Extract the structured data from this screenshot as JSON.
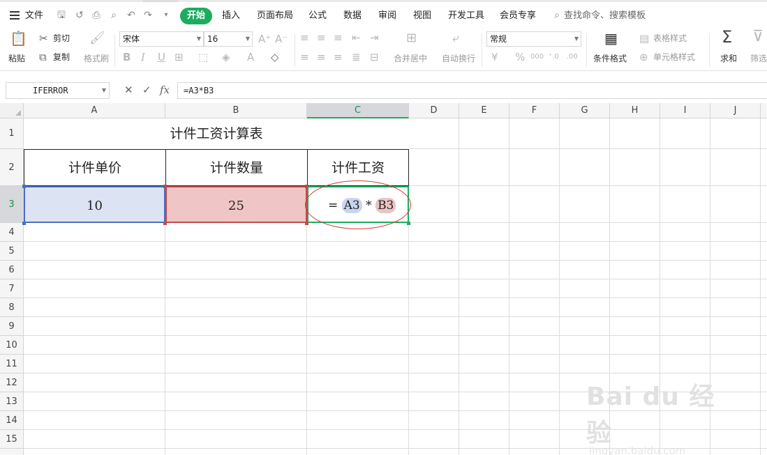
{
  "menubar": {
    "file": "文件",
    "tabs": [
      "开始",
      "插入",
      "页面布局",
      "公式",
      "数据",
      "审阅",
      "视图",
      "开发工具",
      "会员专享"
    ],
    "search": "查找命令、搜索模板"
  },
  "ribbon": {
    "paste": "粘贴",
    "cut": "剪切",
    "copy": "复制",
    "format_painter": "格式刷",
    "font_name": "宋体",
    "font_size": "16",
    "merge_center": "合并居中",
    "wrap_text": "自动换行",
    "number_format": "常规",
    "conditional_format": "条件格式",
    "table_style": "表格样式",
    "cell_style": "单元格样式",
    "sum": "求和",
    "filter": "筛选",
    "bold": "B",
    "italic": "I",
    "underline": "U",
    "currency": "¥",
    "percent": "%",
    "thousands": "000"
  },
  "formula_bar": {
    "name_box": "IFERROR",
    "cancel": "✕",
    "confirm": "✓",
    "fx": "fx",
    "formula": "=A3*B3"
  },
  "grid": {
    "columns": [
      "A",
      "B",
      "C",
      "D",
      "E",
      "F",
      "G",
      "H",
      "I",
      "J"
    ],
    "rows": [
      "1",
      "2",
      "3",
      "4",
      "5",
      "6",
      "7",
      "8",
      "9",
      "10",
      "11",
      "12",
      "13",
      "14",
      "15"
    ],
    "title": "计件工资计算表",
    "headers": [
      "计件单价",
      "计件数量",
      "计件工资"
    ],
    "values": {
      "a3": "10",
      "b3": "25"
    },
    "formula_display": {
      "eq": "=",
      "ref1": "A3",
      "op": "*",
      "ref2": "B3"
    }
  },
  "watermark": {
    "brand": "Bai du 经验",
    "url": "jingyan.baidu.com"
  },
  "colors": {
    "accent": "#1aad5f",
    "ref_blue": "#4a6fc1",
    "ref_red": "#c14a4a",
    "annotation": "#d23b3b"
  }
}
